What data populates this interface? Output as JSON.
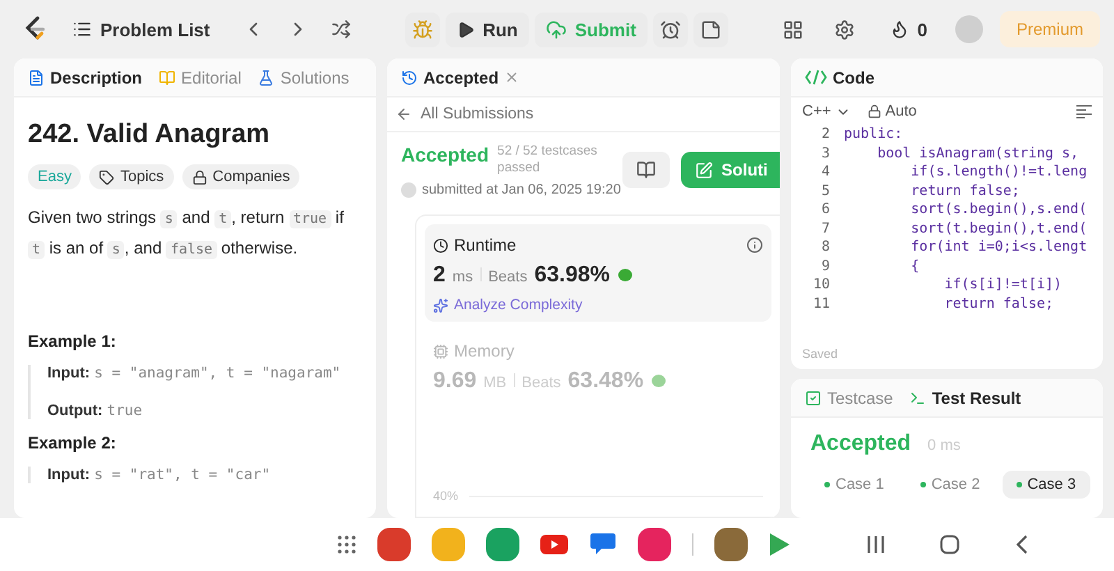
{
  "topbar": {
    "problem_list": "Problem List",
    "run": "Run",
    "submit": "Submit",
    "streak": "0",
    "premium": "Premium"
  },
  "description": {
    "tabs": [
      {
        "label": "Description",
        "selected": true
      },
      {
        "label": "Editorial",
        "selected": false
      },
      {
        "label": "Solutions",
        "selected": false
      }
    ],
    "title": "242. Valid Anagram",
    "tags": [
      {
        "label": "Easy",
        "kind": "difficulty"
      },
      {
        "label": "Topics",
        "kind": "topics"
      },
      {
        "label": "Companies",
        "kind": "companies"
      }
    ],
    "statement": [
      {
        "kind": "text",
        "text": "Given two strings "
      },
      {
        "kind": "code",
        "text": "s"
      },
      {
        "kind": "text",
        "text": " and "
      },
      {
        "kind": "code",
        "text": "t"
      },
      {
        "kind": "text",
        "text": ", return "
      },
      {
        "kind": "code",
        "text": "true"
      },
      {
        "kind": "text",
        "text": " if "
      },
      {
        "kind": "code",
        "text": "t"
      },
      {
        "kind": "text",
        "text": " is an of "
      },
      {
        "kind": "code",
        "text": "s"
      },
      {
        "kind": "text",
        "text": ", and "
      },
      {
        "kind": "code",
        "text": "false"
      },
      {
        "kind": "text",
        "text": " otherwise."
      }
    ],
    "examples": [
      {
        "title": "Example 1:",
        "lines": [
          {
            "label": "Input:",
            "value": "s = \"anagram\", t = \"nagaram\""
          },
          {
            "label": "Output:",
            "value": "true"
          }
        ]
      },
      {
        "title": "Example 2:",
        "lines": [
          {
            "label": "Input:",
            "value": "s = \"rat\", t = \"car\""
          }
        ]
      }
    ]
  },
  "submission": {
    "tab": "Accepted",
    "back": "All Submissions",
    "status": "Accepted",
    "testcases": "52 / 52 testcases passed",
    "submitted": "submitted at Jan 06, 2025 19:20",
    "solution_button": "Soluti",
    "metrics": [
      {
        "kind": "runtime",
        "title": "Runtime",
        "value": "2",
        "unit": "ms",
        "beats_label": "Beats",
        "beats": "63.98%",
        "analyze": "Analyze Complexity",
        "selected": true
      },
      {
        "kind": "memory",
        "title": "Memory",
        "value": "9.69",
        "unit": "MB",
        "beats_label": "Beats",
        "beats": "63.48%",
        "selected": false
      }
    ],
    "chart_tick": "40%"
  },
  "code": {
    "title": "Code",
    "language": "C++",
    "mode": "Auto",
    "status": "Saved",
    "lines": [
      {
        "number": "2",
        "text": "public:"
      },
      {
        "number": "3",
        "text": "    bool isAnagram(string s,"
      },
      {
        "number": "4",
        "text": "        if(s.length()!=t.leng"
      },
      {
        "number": "5",
        "text": "        return false;"
      },
      {
        "number": "6",
        "text": "        sort(s.begin(),s.end("
      },
      {
        "number": "7",
        "text": "        sort(t.begin(),t.end("
      },
      {
        "number": "8",
        "text": "        for(int i=0;i<s.lengt"
      },
      {
        "number": "9",
        "text": "        {"
      },
      {
        "number": "10",
        "text": "            if(s[i]!=t[i])"
      },
      {
        "number": "11",
        "text": "            return false;"
      }
    ]
  },
  "result": {
    "tabs": [
      {
        "label": "Testcase",
        "selected": false
      },
      {
        "label": "Test Result",
        "selected": true
      }
    ],
    "verdict": "Accepted",
    "time": "0 ms",
    "cases": [
      {
        "label": "Case 1",
        "selected": false
      },
      {
        "label": "Case 2",
        "selected": false
      },
      {
        "label": "Case 3",
        "selected": true
      }
    ]
  }
}
